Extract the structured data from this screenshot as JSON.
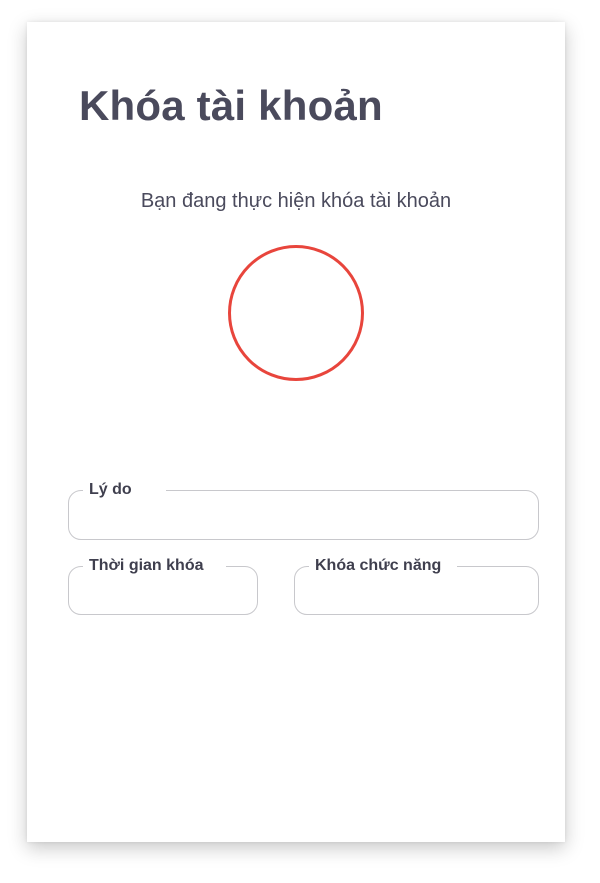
{
  "dialog": {
    "title": "Khóa tài khoản",
    "message": "Bạn đang thực hiện khóa tài khoản",
    "status_ring_color": "#e8453c"
  },
  "form": {
    "reason": {
      "label": "Lý do",
      "value": ""
    },
    "lock_duration": {
      "label": "Thời gian khóa",
      "value": ""
    },
    "lock_function": {
      "label": "Khóa chức năng",
      "value": ""
    }
  }
}
